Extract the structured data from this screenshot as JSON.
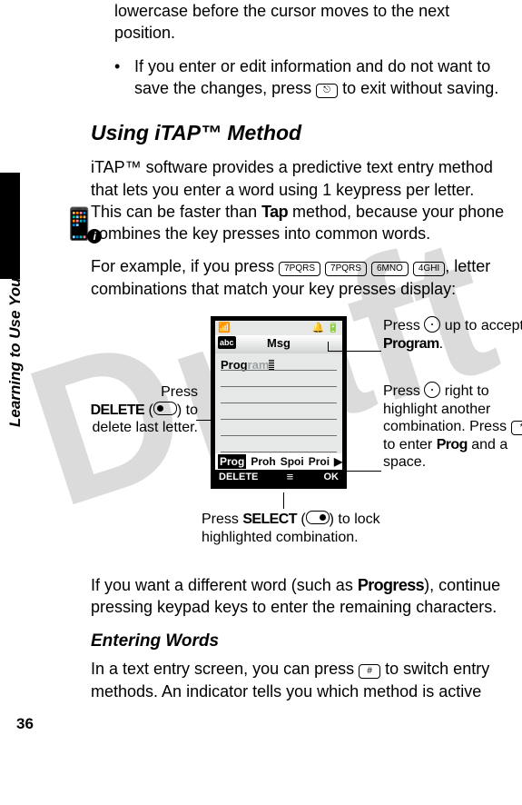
{
  "watermark": "Draft",
  "sidebar": {
    "label": "Learning to Use Your Phone"
  },
  "page_number": "36",
  "para_top": "lowercase before the cursor moves to the next position.",
  "bullet2_a": "If you enter or edit information and do not want to save the changes, press ",
  "bullet2_key": "⎋",
  "bullet2_b": " to exit without saving.",
  "heading1": "Using iTAP™ Method",
  "p_itap_a": "iTAP™ software provides a predictive text entry method that lets you enter a word using 1 keypress per letter. This can be faster than ",
  "tap_word": "Tap",
  "p_itap_b": " method, because your phone combines the key presses into common words.",
  "p_example_a": "For example, if you press ",
  "keys": {
    "k1": "7PQRS",
    "k2": "7PQRS",
    "k3": "6MNO",
    "k4": "4GHI"
  },
  "p_example_b": ", letter combinations that match your key presses display:",
  "screen": {
    "abc": "abc",
    "title": "Msg",
    "entry_prefix": "Prog",
    "entry_grey": "ram",
    "suggestions": {
      "sel": "Prog",
      "s2": "Proh",
      "s3": "Spoi",
      "s4": "Proi",
      "arrow": "▶"
    },
    "softkeys": {
      "left": "DELETE",
      "menu": "≡",
      "right": "OK"
    }
  },
  "callouts": {
    "right1_a": "Press ",
    "right1_b": " up to accept ",
    "right1_word": "Program",
    "right1_dot": ".",
    "right2_a": "Press ",
    "right2_b": " right to highlight another combination. Press ",
    "right2_key": "*",
    "right2_c": " to enter ",
    "right2_word": "Prog",
    "right2_d": " and a space.",
    "left1_a": "Press",
    "left1_word": "DELETE",
    "left1_b": " (",
    "left1_c": ") to delete last letter.",
    "bottom_a": "Press ",
    "bottom_word": "SELECT",
    "bottom_b": " (",
    "bottom_c": ") to lock highlighted combination."
  },
  "p_after_a": "If you want a different word (such as ",
  "progress_word": "Progress",
  "p_after_b": "), continue pressing keypad keys to enter the remaining characters.",
  "heading2": "Entering Words",
  "p_enter_a": "In a text entry screen, you can press ",
  "enter_key": "#",
  "p_enter_b": " to switch entry methods. An indicator tells you which method is active"
}
